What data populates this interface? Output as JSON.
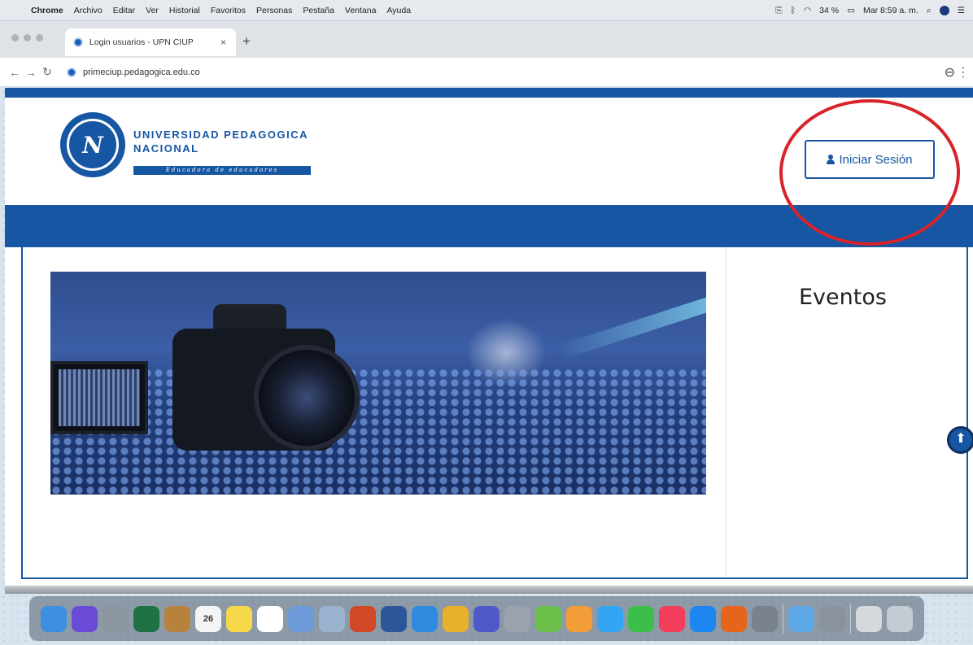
{
  "menubar": {
    "app": "Chrome",
    "items": [
      "Archivo",
      "Editar",
      "Ver",
      "Historial",
      "Favoritos",
      "Personas",
      "Pestaña",
      "Ventana",
      "Ayuda"
    ],
    "battery": "34 %",
    "clock": "Mar 8:59 a. m."
  },
  "browser": {
    "tab_title": "Login usuarios - UPN CIUP",
    "tab_close": "×",
    "new_tab": "+",
    "url": "primeciup.pedagogica.edu.co"
  },
  "site": {
    "logo_line1": "UNIVERSIDAD PEDAGOGICA",
    "logo_line2": "NACIONAL",
    "logo_tagline": "Educadora de educadores",
    "login_label": "Iniciar Sesión",
    "events_title": "Eventos",
    "brand_color": "#1656a3",
    "annotation_color": "#d8232a"
  },
  "dock": {
    "calendar_day": "26",
    "apps": [
      {
        "name": "finder",
        "color": "#3d8fe0"
      },
      {
        "name": "siri",
        "color": "#6a4bd6"
      },
      {
        "name": "launchpad",
        "color": "#8c96a3"
      },
      {
        "name": "excel",
        "color": "#1f7244"
      },
      {
        "name": "notes-book",
        "color": "#b8823c"
      },
      {
        "name": "calendar",
        "color": "#f4f4f4"
      },
      {
        "name": "stickies",
        "color": "#f5d94a"
      },
      {
        "name": "reminders",
        "color": "#ffffff"
      },
      {
        "name": "preview",
        "color": "#6d9ad8"
      },
      {
        "name": "photos-app",
        "color": "#9bb3cf"
      },
      {
        "name": "powerpoint",
        "color": "#d24726"
      },
      {
        "name": "word",
        "color": "#2b579a"
      },
      {
        "name": "safari",
        "color": "#2f8be0"
      },
      {
        "name": "chrome",
        "color": "#e8b02b"
      },
      {
        "name": "teams",
        "color": "#5059c9"
      },
      {
        "name": "help",
        "color": "#9aa3ad"
      },
      {
        "name": "maps",
        "color": "#6cc04a"
      },
      {
        "name": "photos",
        "color": "#f29d38"
      },
      {
        "name": "messages",
        "color": "#34a5f5"
      },
      {
        "name": "facetime",
        "color": "#3cbf4a"
      },
      {
        "name": "music",
        "color": "#f33e5b"
      },
      {
        "name": "app-store",
        "color": "#1e86f0"
      },
      {
        "name": "firefox",
        "color": "#e5661b"
      },
      {
        "name": "system-preferences",
        "color": "#7a828c"
      },
      {
        "name": "icloud",
        "color": "#5fa8e8"
      },
      {
        "name": "dock-extra",
        "color": "#8a939d"
      },
      {
        "name": "files",
        "color": "#d5d9de"
      },
      {
        "name": "trash",
        "color": "#c5cbd2"
      }
    ]
  }
}
